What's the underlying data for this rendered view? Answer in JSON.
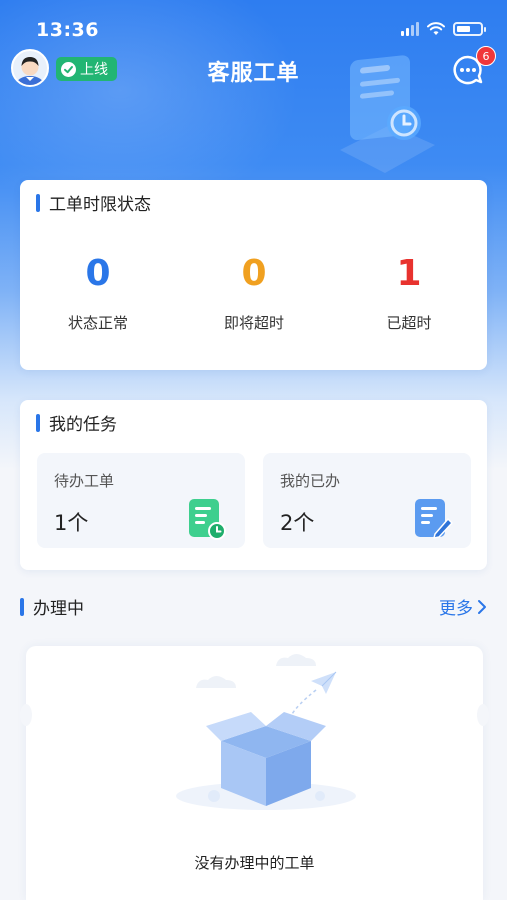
{
  "status_bar": {
    "time": "13:36"
  },
  "header": {
    "title": "客服工单",
    "online_label": "上线",
    "message_count": "6"
  },
  "status_card": {
    "title": "工单时限状态",
    "stats": [
      {
        "value": "0",
        "label": "状态正常",
        "color": "#2a76e8"
      },
      {
        "value": "0",
        "label": "即将超时",
        "color": "#f0a020"
      },
      {
        "value": "1",
        "label": "已超时",
        "color": "#e8322e"
      }
    ]
  },
  "task_card": {
    "title": "我的任务",
    "tiles": [
      {
        "label": "待办工单",
        "value": "1个",
        "icon": "pending-doc-icon"
      },
      {
        "label": "我的已办",
        "value": "2个",
        "icon": "done-doc-icon"
      }
    ]
  },
  "in_progress": {
    "title": "办理中",
    "more_label": "更多",
    "empty_text": "没有办理中的工单"
  },
  "colors": {
    "primary": "#2a76e8",
    "online": "#22b573",
    "badge": "#f0373a"
  }
}
